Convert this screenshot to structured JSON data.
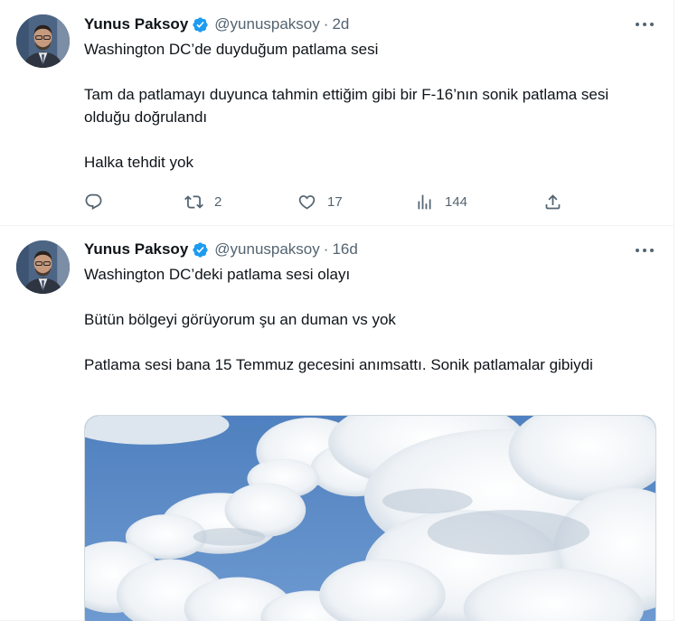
{
  "tweets": [
    {
      "author": "Yunus Paksoy",
      "handle": "@yunuspaksoy",
      "separator": "·",
      "time": "2d",
      "text": "Washington DC’de duyduğum patlama sesi\n\nTam da patlamayı duyunca tahmin ettiğim gibi bir F-16’nın sonik patlama sesi olduğu doğrulandı\n\nHalka tehdit yok",
      "replies": "",
      "retweets": "2",
      "likes": "17",
      "views": "144"
    },
    {
      "author": "Yunus Paksoy",
      "handle": "@yunuspaksoy",
      "separator": "·",
      "time": "16d",
      "text": "Washington DC’deki patlama sesi olayı\n\nBütün bölgeyi görüyorum şu an duman vs yok\n\nPatlama sesi bana 15 Temmuz gecesini anımsattı. Sonik patlamalar gibiydi"
    }
  ],
  "icons": {
    "verified": "verified-badge-icon",
    "more": "more-icon",
    "reply": "reply-icon",
    "retweet": "retweet-icon",
    "like": "heart-icon",
    "views": "views-icon",
    "share": "share-icon"
  },
  "colors": {
    "verified": "#1d9bf0",
    "secondary_text": "#536471",
    "sky": "#5a89c4"
  }
}
